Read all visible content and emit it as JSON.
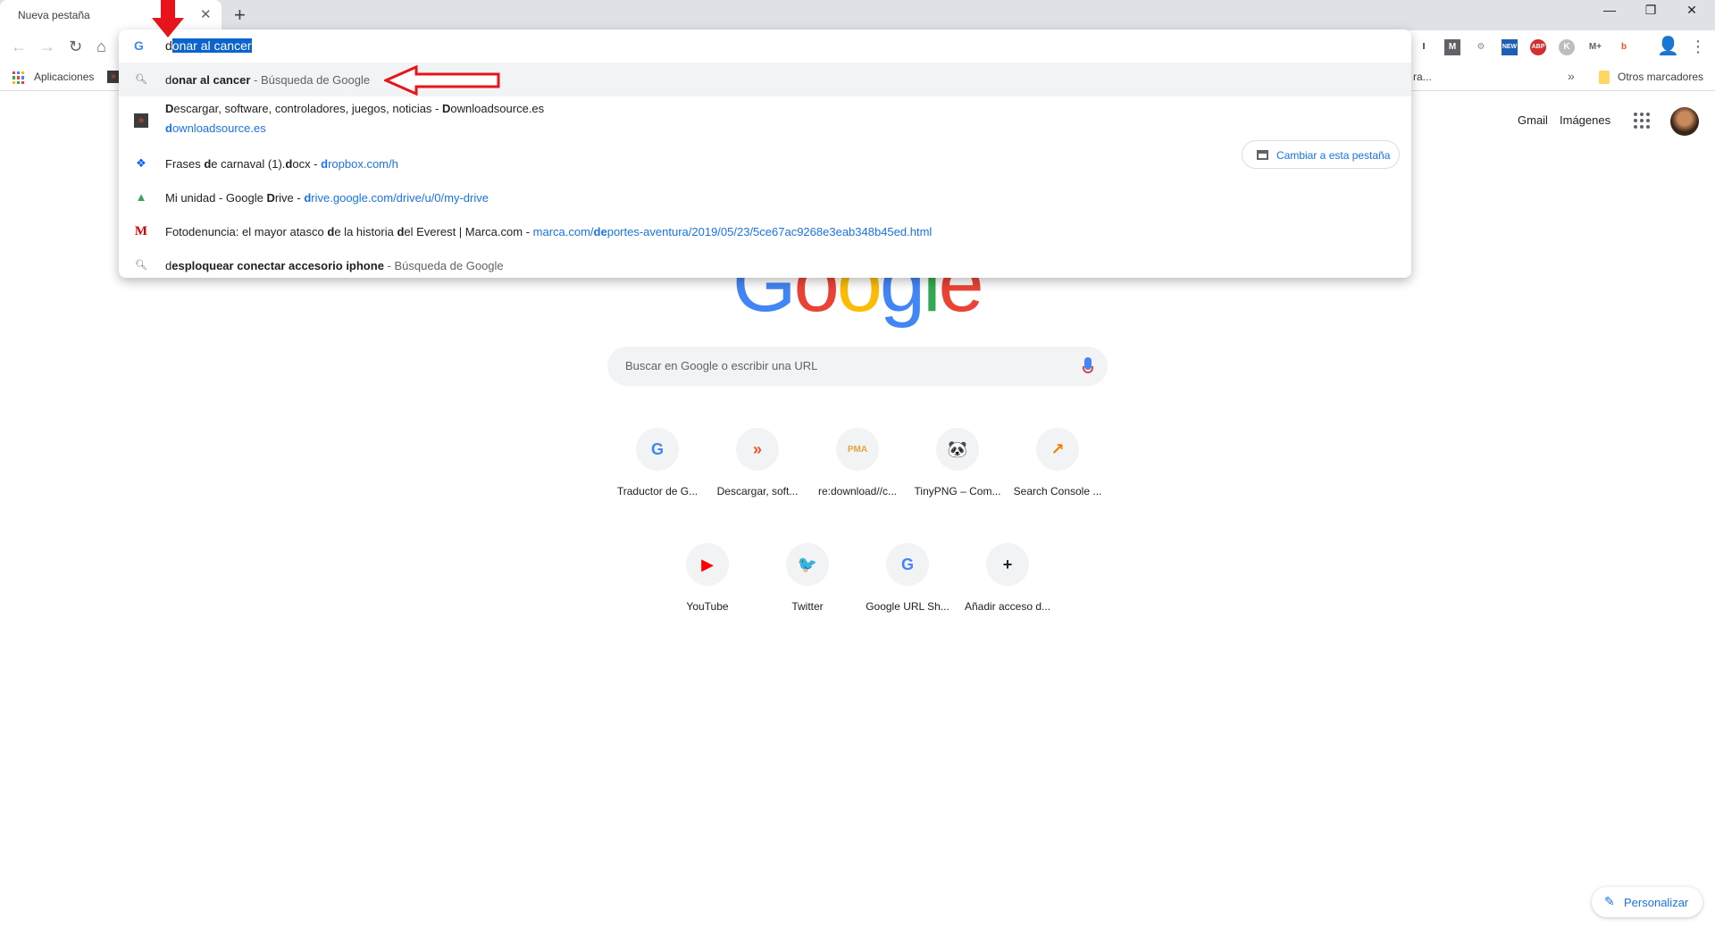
{
  "tab": {
    "title": "Nueva pestaña",
    "close": "✕",
    "new_tab": "+"
  },
  "window": {
    "minimize": "—",
    "restore": "❐",
    "close": "✕"
  },
  "toolbar": {
    "back": "←",
    "forward": "→",
    "reload": "↻",
    "home": "⌂",
    "extensions": [
      {
        "name": "instapaper",
        "glyph": "I",
        "color": "#202124",
        "bg": "#fff"
      },
      {
        "name": "m-extension",
        "glyph": "M",
        "color": "#fff",
        "bg": "#5f6368"
      },
      {
        "name": "settings-gear",
        "glyph": "⚙",
        "color": "#888",
        "bg": "#fff"
      },
      {
        "name": "new-badge",
        "glyph": "NEW",
        "color": "#fff",
        "bg": "#1a5fb4"
      },
      {
        "name": "adblock-plus",
        "glyph": "ABP",
        "color": "#fff",
        "bg": "#d32f2f"
      },
      {
        "name": "k-extension",
        "glyph": "K",
        "color": "#fff",
        "bg": "#bdbdbd"
      },
      {
        "name": "movistar-plus",
        "glyph": "M+",
        "color": "#5f6368",
        "bg": "#fff"
      },
      {
        "name": "b-extension",
        "glyph": "b",
        "color": "#f4511e",
        "bg": "#fff"
      }
    ],
    "profile": "👤",
    "menu": "⋮"
  },
  "bookmarks": {
    "apps_label": "Aplicaciones",
    "truncated": "ra...",
    "overflow": "»",
    "other_label": "Otros marcadores"
  },
  "omnibox": {
    "typed": "d",
    "autocomplete": "onar al cancer",
    "suggestions": [
      {
        "icon": "search",
        "parts": [
          [
            "d",
            ""
          ],
          [
            "onar al cancer",
            "b"
          ],
          [
            " - Búsqueda de Google",
            "dim"
          ]
        ]
      },
      {
        "icon": "downloadsource",
        "parts": [
          [
            "D",
            "b"
          ],
          [
            "escargar, software, controladores, juegos, noticias - ",
            ""
          ],
          [
            "D",
            "b"
          ],
          [
            "ownloadsource.es",
            ""
          ]
        ],
        "line2": [
          [
            "d",
            "bu"
          ],
          [
            "ownloadsource.es",
            "url"
          ]
        ]
      },
      {
        "icon": "dropbox",
        "parts": [
          [
            "Frases ",
            ""
          ],
          [
            "d",
            "b"
          ],
          [
            "e carnaval (1).",
            ""
          ],
          [
            "d",
            "b"
          ],
          [
            "ocx - ",
            ""
          ],
          [
            "d",
            "bu"
          ],
          [
            "ropbox.com/h",
            "url"
          ]
        ]
      },
      {
        "icon": "drive",
        "parts": [
          [
            "Mi unidad - Google ",
            ""
          ],
          [
            "D",
            "b"
          ],
          [
            "rive - ",
            ""
          ],
          [
            "d",
            "bu"
          ],
          [
            "rive.google.com/drive/u/0/my-drive",
            "url"
          ]
        ]
      },
      {
        "icon": "marca",
        "parts": [
          [
            "Fotodenuncia: el mayor atasco ",
            ""
          ],
          [
            "d",
            "b"
          ],
          [
            "e la historia ",
            ""
          ],
          [
            "d",
            "b"
          ],
          [
            "el Everest | Marca.com - ",
            ""
          ],
          [
            "marca.com/",
            "url"
          ],
          [
            "de",
            "bu"
          ],
          [
            "portes-aventura/2019/05/23/5ce67ac9268e3eab348b45ed.html",
            "url"
          ]
        ]
      },
      {
        "icon": "search",
        "parts": [
          [
            "d",
            ""
          ],
          [
            "esploquear conectar accesorio iphone",
            "b"
          ],
          [
            " - Búsqueda de Google",
            "dim"
          ]
        ]
      }
    ],
    "switch_tab_label": "Cambiar a esta pestaña"
  },
  "ntp": {
    "gmail": "Gmail",
    "images": "Imágenes",
    "search_placeholder": "Buscar en Google o escribir una URL",
    "shortcuts_row1": [
      {
        "label": "Traductor de G...",
        "glyph": "G",
        "color": "#4285f4"
      },
      {
        "label": "Descargar, soft...",
        "glyph": "»",
        "color": "#f4511e"
      },
      {
        "label": "re:download//c...",
        "glyph": "PMA",
        "color": "#e8a33d"
      },
      {
        "label": "TinyPNG – Com...",
        "glyph": "🐼",
        "color": "#202124"
      },
      {
        "label": "Search Console ...",
        "glyph": "↗",
        "color": "#f57c00"
      }
    ],
    "shortcuts_row2": [
      {
        "label": "YouTube",
        "glyph": "▶",
        "color": "#ff0000"
      },
      {
        "label": "Twitter",
        "glyph": "🐦",
        "color": "#1da1f2"
      },
      {
        "label": "Google URL Sh...",
        "glyph": "G",
        "color": "#4285f4"
      },
      {
        "label": "Añadir acceso d...",
        "glyph": "+",
        "color": "#202124"
      }
    ],
    "customize_label": "Personalizar"
  },
  "colors": {
    "accent": "#1a73e8",
    "annotation_red": "#e8141c",
    "tabstrip": "#dee1e6"
  }
}
